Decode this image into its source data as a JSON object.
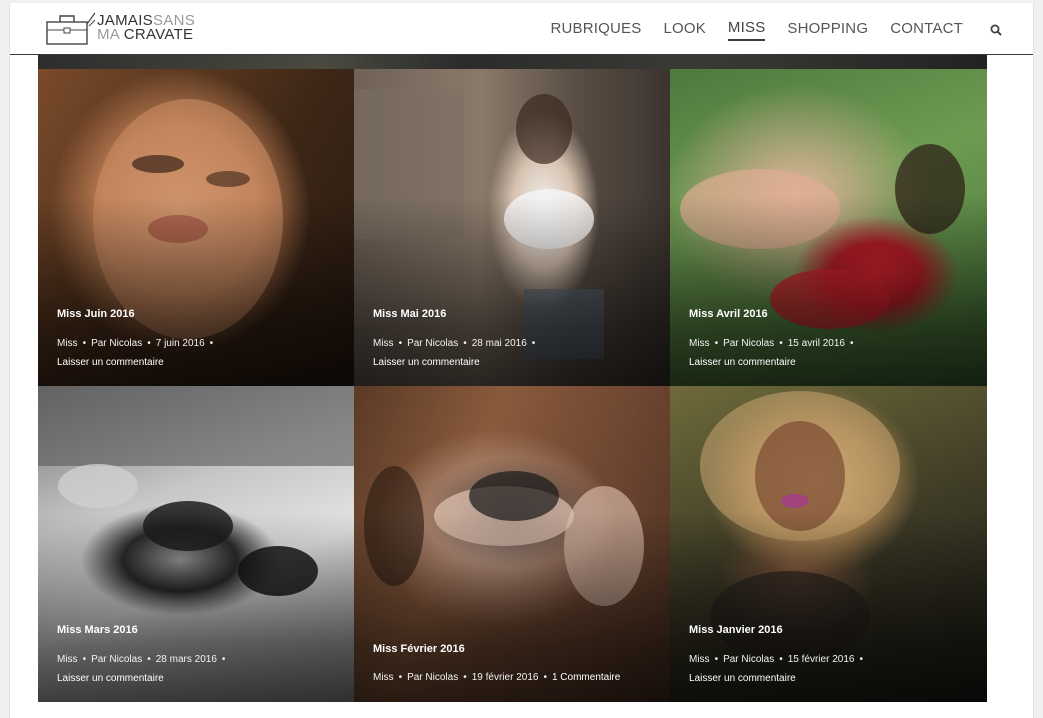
{
  "header": {
    "logo": {
      "line1_a": "JAMAIS",
      "line1_b": "SANS",
      "line2_a": "MA",
      "line2_b": "CRAVATE"
    },
    "nav": [
      {
        "label": "RUBRIQUES",
        "active": false
      },
      {
        "label": "LOOK",
        "active": false
      },
      {
        "label": "MISS",
        "active": true
      },
      {
        "label": "SHOPPING",
        "active": false
      },
      {
        "label": "CONTACT",
        "active": false
      }
    ],
    "search_icon": "search-icon"
  },
  "posts": [
    {
      "title": "Miss Juin 2016",
      "category": "Miss",
      "author": "Par Nicolas",
      "date": "7 juin 2016",
      "comments": "Laisser un commentaire"
    },
    {
      "title": "Miss Mai 2016",
      "category": "Miss",
      "author": "Par Nicolas",
      "date": "28 mai 2016",
      "comments": "Laisser un commentaire"
    },
    {
      "title": "Miss Avril 2016",
      "category": "Miss",
      "author": "Par Nicolas",
      "date": "15 avril 2016",
      "comments": "Laisser un commentaire"
    },
    {
      "title": "Miss Mars 2016",
      "category": "Miss",
      "author": "Par Nicolas",
      "date": "28 mars 2016",
      "comments": "Laisser un commentaire"
    },
    {
      "title": "Miss Février 2016",
      "category": "Miss",
      "author": "Par Nicolas",
      "date": "19 février 2016",
      "comments": "1 Commentaire"
    },
    {
      "title": "Miss Janvier 2016",
      "category": "Miss",
      "author": "Par Nicolas",
      "date": "15 février 2016",
      "comments": "Laisser un commentaire"
    }
  ],
  "colors": {
    "header_border": "#3a3a3a",
    "nav_text": "#555555",
    "logo_dark": "#333333",
    "logo_light": "#9a9a9a"
  }
}
